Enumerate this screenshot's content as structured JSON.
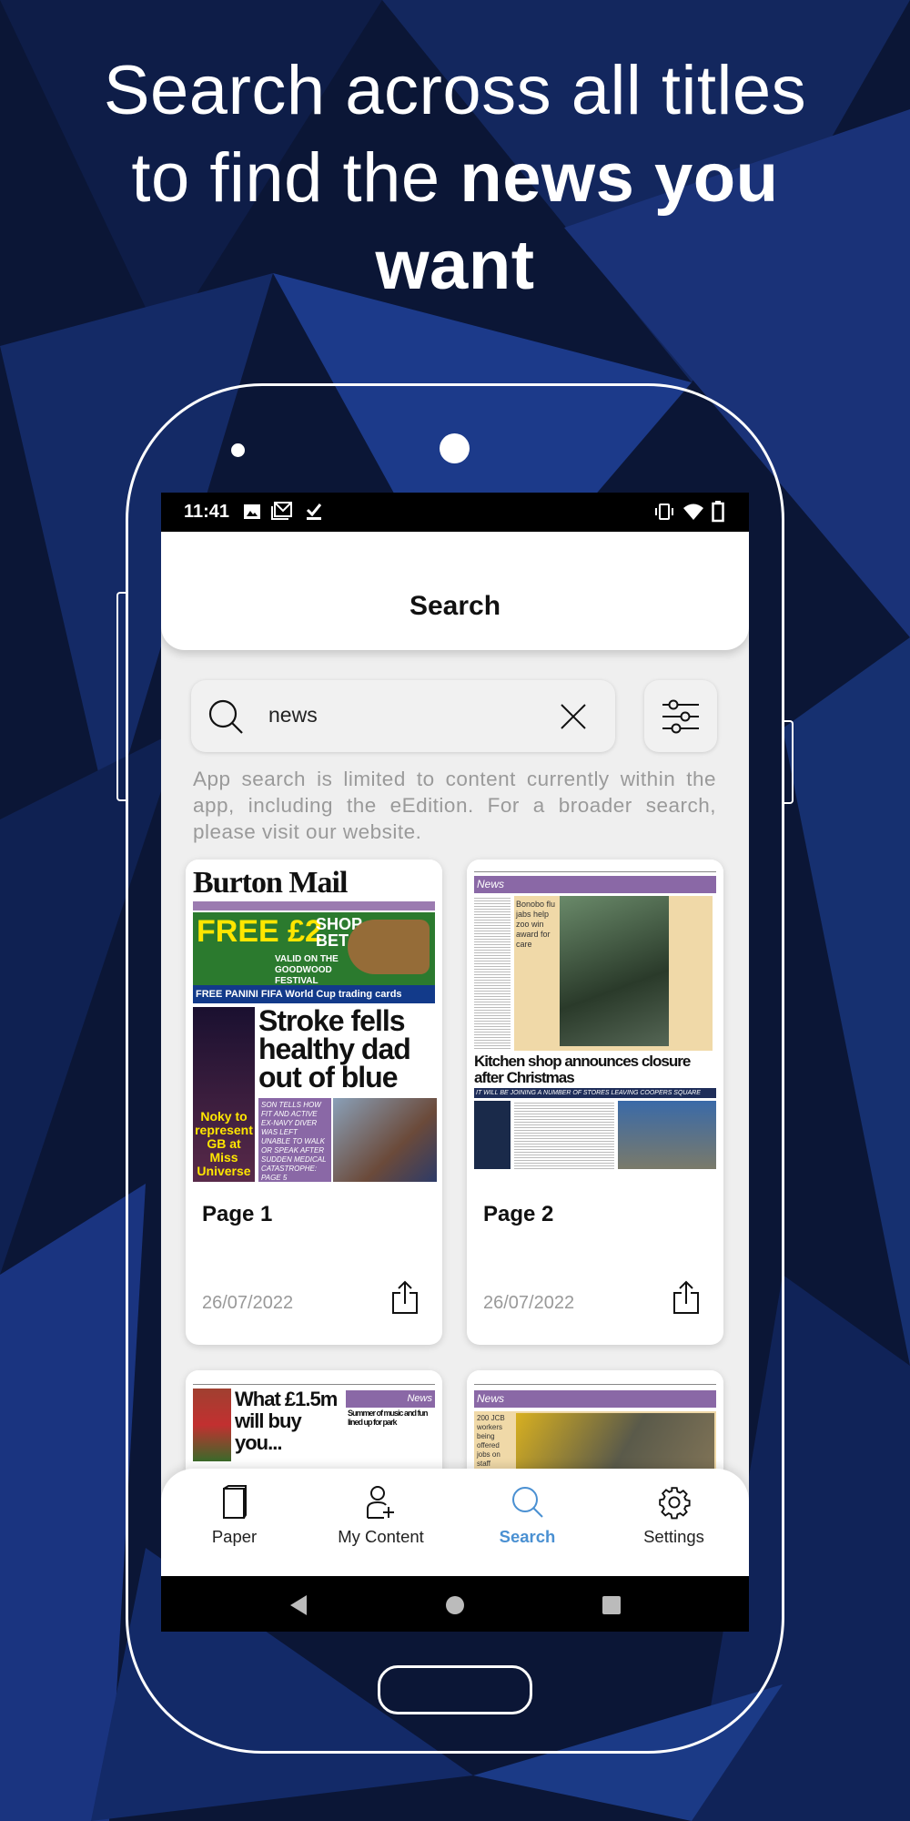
{
  "promo": {
    "line1": "Search across all titles",
    "line2_pre": "to find the ",
    "line2_bold": "news you",
    "line3_bold": "want"
  },
  "colors": {
    "background": "#0b1636",
    "accent": "#4a90d2",
    "phone_outline": "#ffffff"
  },
  "status_bar": {
    "time": "11:41",
    "left_icons": [
      "image-icon",
      "gmail-icon",
      "download-done-icon"
    ],
    "right_icons": [
      "vibrate-icon",
      "wifi-icon",
      "battery-icon"
    ]
  },
  "header": {
    "title": "Search"
  },
  "search": {
    "value": "news",
    "icon": "search-icon",
    "clear_icon": "close-icon",
    "filter_icon": "sliders-icon"
  },
  "info_text": "App search is limited to content currently within the app, including the eEdition. For a broader search, please visit our website.",
  "results": [
    {
      "page": "Page 1",
      "date": "26/07/2022",
      "thumb": {
        "masthead": "Burton Mail",
        "promo1": "FREE £2",
        "promo2": "SHOP BET",
        "promo3": "VALID ON THE GOODWOOD FESTIVAL",
        "promo4": "FREE PANINI FIFA World Cup trading cards",
        "headline": "Stroke fells healthy dad out of blue",
        "side": "Noky to represent GB at Miss Universe",
        "sub": "SON TELLS HOW FIT AND ACTIVE EX-NAVY DIVER WAS LEFT UNABLE TO WALK OR SPEAK AFTER SUDDEN MEDICAL CATASTROPHE: PAGE 5"
      }
    },
    {
      "page": "Page 2",
      "date": "26/07/2022",
      "thumb": {
        "section": "News",
        "story1": "Bonobo flu jabs help zoo win award for care",
        "headline": "Kitchen shop announces closure after Christmas",
        "sub": "IT WILL BE JOINING A NUMBER OF STORES LEAVING COOPERS SQUARE"
      }
    },
    {
      "thumb": {
        "headline": "What £1.5m will buy you...",
        "section": "News",
        "side": "Summer of music and fun lined up for park"
      }
    },
    {
      "thumb": {
        "section": "News",
        "story1": "200 JCB workers being offered jobs on staff"
      }
    }
  ],
  "bottom_nav": [
    {
      "label": "Paper",
      "icon": "paper-icon",
      "active": false
    },
    {
      "label": "My Content",
      "icon": "add-user-icon",
      "active": false
    },
    {
      "label": "Search",
      "icon": "search-icon",
      "active": true
    },
    {
      "label": "Settings",
      "icon": "gear-icon",
      "active": false
    }
  ],
  "system_nav": [
    "back-icon",
    "home-icon",
    "recents-icon"
  ]
}
